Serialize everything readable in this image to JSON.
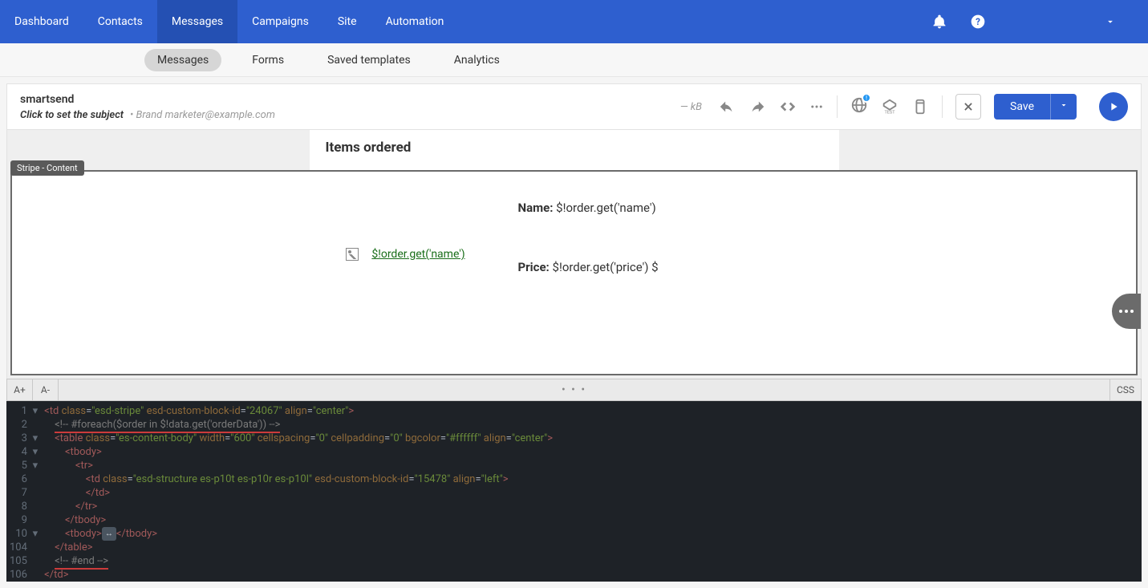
{
  "topnav": {
    "items": [
      "Dashboard",
      "Contacts",
      "Messages",
      "Campaigns",
      "Site",
      "Automation"
    ],
    "active": 2
  },
  "subnav": {
    "items": [
      "Messages",
      "Forms",
      "Saved templates",
      "Analytics"
    ],
    "active": 0
  },
  "header": {
    "campaign_name": "smartsend",
    "subject_placeholder": "Click to set the subject",
    "sender": "• Brand marketer@example.com",
    "size": "— kB",
    "save_label": "Save"
  },
  "canvas": {
    "title": "Items ordered",
    "stripe_label": "Stripe - Content",
    "img_link": "$!order.get('name')",
    "name_label": "Name:",
    "name_value": "$!order.get('name')",
    "price_label": "Price:",
    "price_value": "$!order.get('price') $"
  },
  "editor_toolbar": {
    "inc": "A+",
    "dec": "A-",
    "css": "CSS"
  },
  "code": {
    "lines": [
      {
        "n": "1",
        "indent": 0,
        "tokens": [
          [
            "tag",
            "<td"
          ],
          [
            "sp",
            " "
          ],
          [
            "attr",
            "class"
          ],
          [
            "op",
            "="
          ],
          [
            "str",
            "\"esd-stripe\""
          ],
          [
            "sp",
            " "
          ],
          [
            "attr",
            "esd-custom-block-id"
          ],
          [
            "op",
            "="
          ],
          [
            "str",
            "\"24067\""
          ],
          [
            "sp",
            " "
          ],
          [
            "attr",
            "align"
          ],
          [
            "op",
            "="
          ],
          [
            "str",
            "\"center\""
          ],
          [
            "tag",
            ">"
          ]
        ]
      },
      {
        "n": "2",
        "indent": 1,
        "tokens": [
          [
            "cmt",
            "<!-- #foreach($order in $!data.get('orderData')) -->"
          ]
        ],
        "underline": true
      },
      {
        "n": "3",
        "indent": 1,
        "tokens": [
          [
            "tag",
            "<table"
          ],
          [
            "sp",
            " "
          ],
          [
            "attr",
            "class"
          ],
          [
            "op",
            "="
          ],
          [
            "str",
            "\"es-content-body\""
          ],
          [
            "sp",
            " "
          ],
          [
            "attr",
            "width"
          ],
          [
            "op",
            "="
          ],
          [
            "str",
            "\"600\""
          ],
          [
            "sp",
            " "
          ],
          [
            "attr",
            "cellspacing"
          ],
          [
            "op",
            "="
          ],
          [
            "str",
            "\"0\""
          ],
          [
            "sp",
            " "
          ],
          [
            "attr",
            "cellpadding"
          ],
          [
            "op",
            "="
          ],
          [
            "str",
            "\"0\""
          ],
          [
            "sp",
            " "
          ],
          [
            "attr",
            "bgcolor"
          ],
          [
            "op",
            "="
          ],
          [
            "str",
            "\"#ffffff\""
          ],
          [
            "sp",
            " "
          ],
          [
            "attr",
            "align"
          ],
          [
            "op",
            "="
          ],
          [
            "str",
            "\"center\""
          ],
          [
            "tag",
            ">"
          ]
        ]
      },
      {
        "n": "4",
        "indent": 2,
        "tokens": [
          [
            "tag",
            "<tbody>"
          ]
        ]
      },
      {
        "n": "5",
        "indent": 3,
        "tokens": [
          [
            "tag",
            "<tr>"
          ]
        ]
      },
      {
        "n": "6",
        "indent": 4,
        "tokens": [
          [
            "tag",
            "<td"
          ],
          [
            "sp",
            " "
          ],
          [
            "attr",
            "class"
          ],
          [
            "op",
            "="
          ],
          [
            "str",
            "\"esd-structure es-p10t es-p10r es-p10l\""
          ],
          [
            "sp",
            " "
          ],
          [
            "attr",
            "esd-custom-block-id"
          ],
          [
            "op",
            "="
          ],
          [
            "str",
            "\"15478\""
          ],
          [
            "sp",
            " "
          ],
          [
            "attr",
            "align"
          ],
          [
            "op",
            "="
          ],
          [
            "str",
            "\"left\""
          ],
          [
            "tag",
            ">"
          ]
        ]
      },
      {
        "n": "7",
        "indent": 4,
        "tokens": [
          [
            "tag",
            "</td>"
          ]
        ]
      },
      {
        "n": "8",
        "indent": 3,
        "tokens": [
          [
            "tag",
            "</tr>"
          ]
        ]
      },
      {
        "n": "9",
        "indent": 2,
        "tokens": [
          [
            "tag",
            "</tbody>"
          ]
        ]
      },
      {
        "n": "10",
        "indent": 2,
        "tokens": [
          [
            "tag",
            "<tbody>"
          ],
          [
            "fold",
            "↔"
          ],
          [
            "tag",
            "</tbody>"
          ]
        ]
      },
      {
        "n": "104",
        "indent": 1,
        "tokens": [
          [
            "tag",
            "</table>"
          ]
        ]
      },
      {
        "n": "105",
        "indent": 1,
        "tokens": [
          [
            "cmt",
            "<!-- #end -->"
          ]
        ],
        "underline": true
      },
      {
        "n": "106",
        "indent": 0,
        "tokens": [
          [
            "tag",
            "</td>"
          ]
        ]
      }
    ]
  }
}
